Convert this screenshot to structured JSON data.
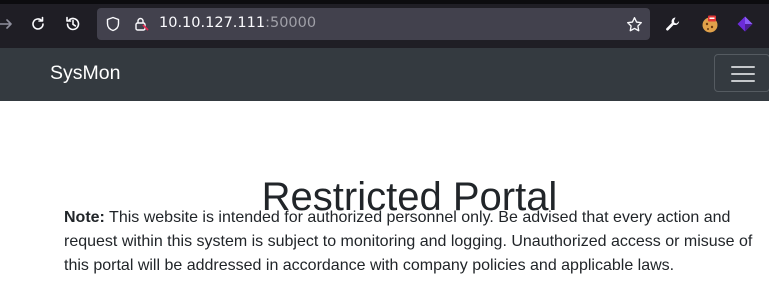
{
  "browser": {
    "url_host": "10.10.127.111",
    "url_port": ":50000"
  },
  "navbar": {
    "brand": "SysMon"
  },
  "main": {
    "title": "Restricted Portal",
    "note_label": "Note:",
    "note_text": " This website is intended for authorized personnel only. Be advised that every action and request within this system is subject to monitoring and logging. Unauthorized access or misuse of this portal will be addressed in accordance with company policies and applicable laws."
  },
  "icons": {
    "forward": "arrow-right-icon",
    "reload": "reload-icon",
    "history": "history-icon",
    "shield": "shield-icon",
    "lock": "lock-icon",
    "bookmark": "star-icon",
    "tools": "wrench-icon",
    "ext1": "cookie-extension-icon",
    "ext2": "purple-extension-icon",
    "menu": "hamburger-menu-icon"
  }
}
